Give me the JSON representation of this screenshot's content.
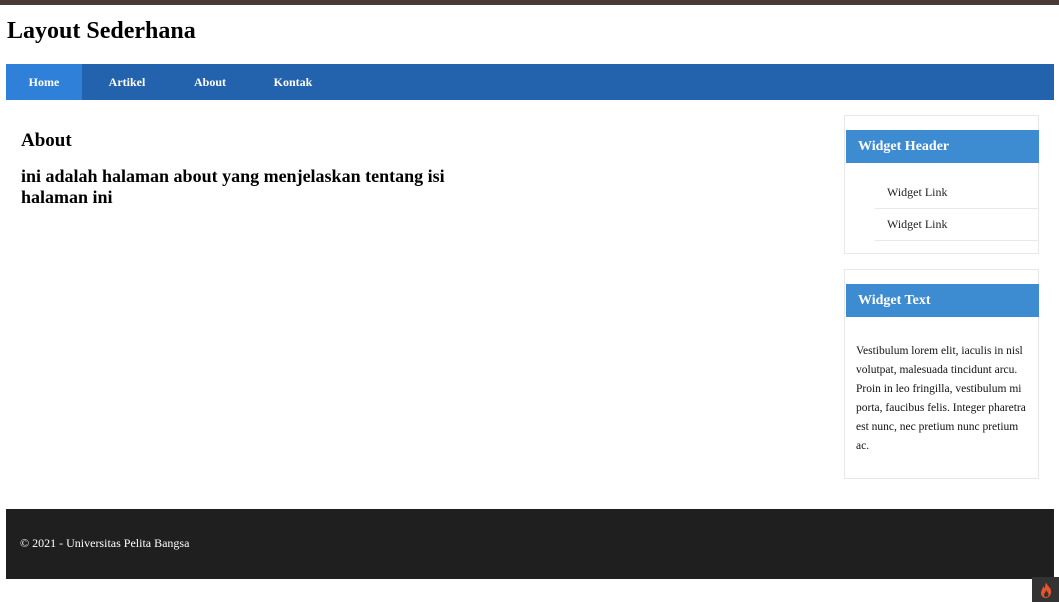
{
  "site": {
    "title": "Layout Sederhana"
  },
  "nav": {
    "items": [
      {
        "label": "Home"
      },
      {
        "label": "Artikel"
      },
      {
        "label": "About"
      },
      {
        "label": "Kontak"
      }
    ]
  },
  "content": {
    "title": "About",
    "text": "ini adalah halaman about yang menjelaskan tentang isi halaman ini"
  },
  "sidebar": {
    "widget_header": {
      "title": "Widget Header",
      "links": [
        "Widget Link",
        "Widget Link"
      ]
    },
    "widget_text": {
      "title": "Widget Text",
      "body": "Vestibulum lorem elit, iaculis in nisl volutpat, malesuada tincidunt arcu. Proin in leo fringilla, vestibulum mi porta, faucibus felis. Integer pharetra est nunc, nec pretium nunc pretium ac."
    }
  },
  "footer": {
    "text": "© 2021 - Universitas Pelita Bangsa"
  },
  "colors": {
    "nav": "#2362ad",
    "nav_active": "#2e80d8",
    "widget_header": "#3d8bd0",
    "footer": "#1f1f1f",
    "top_strip": "#4a3a36"
  },
  "icons": {
    "corner_badge": "flame-icon"
  }
}
